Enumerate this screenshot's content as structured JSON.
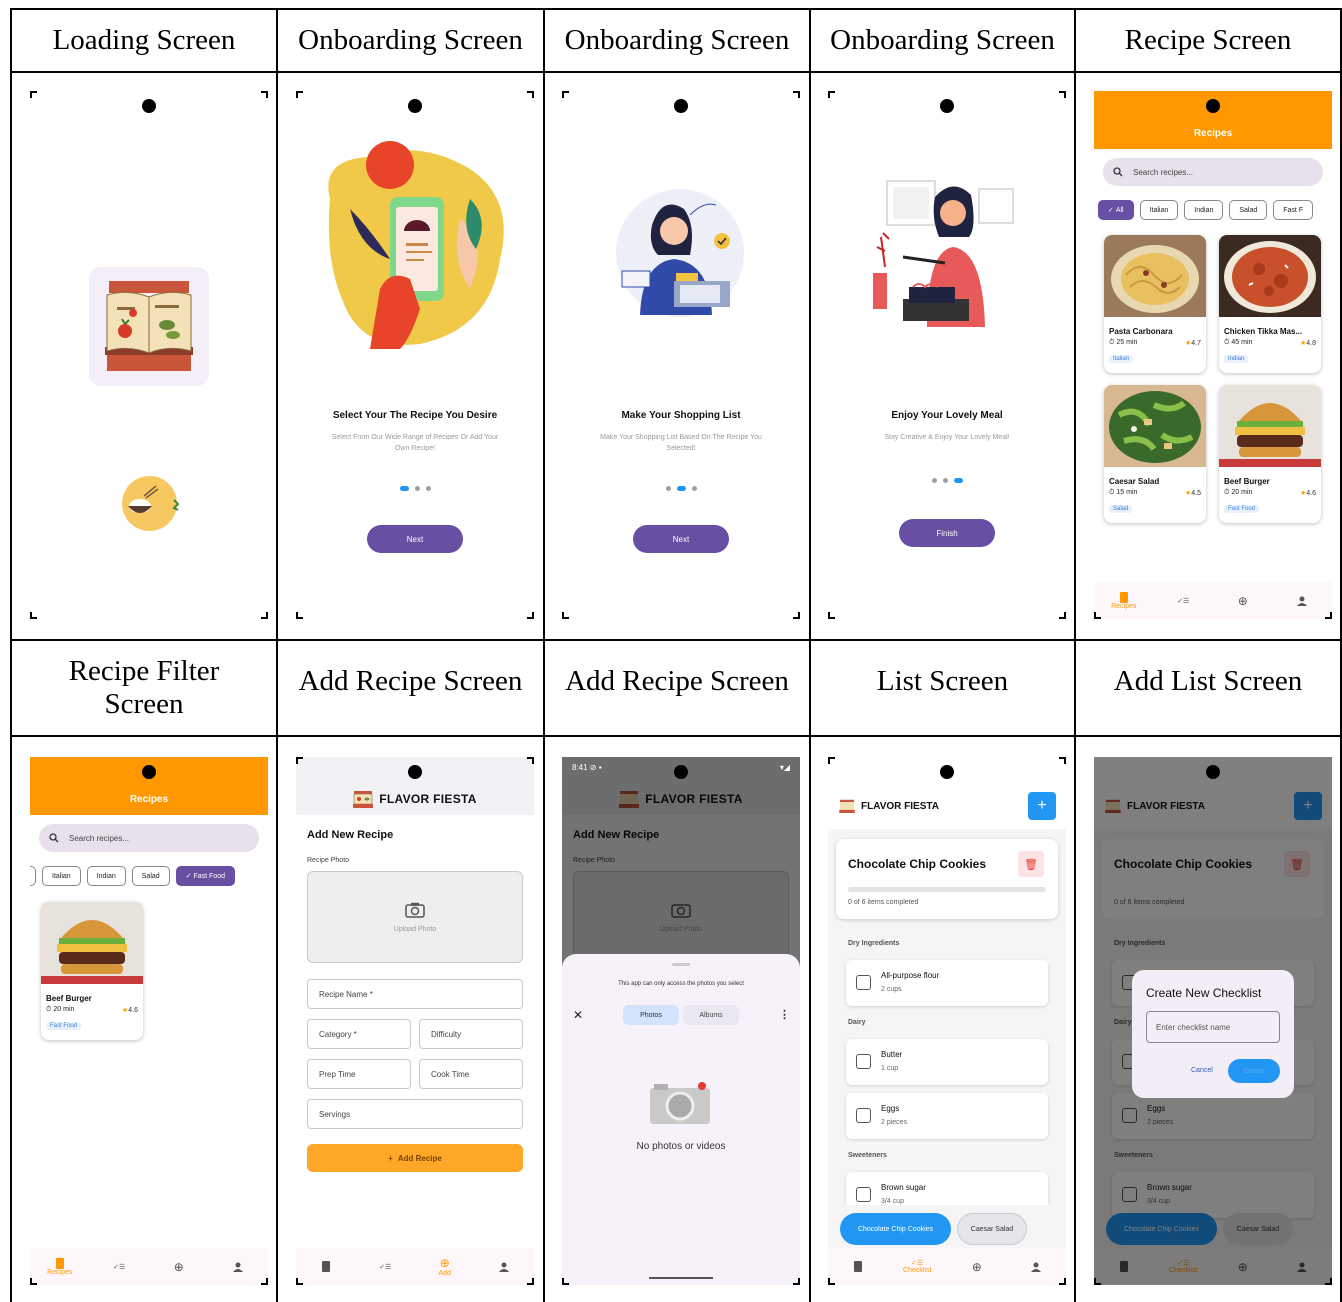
{
  "headers": [
    "Loading Screen",
    "Onboarding Screen",
    "Onboarding Screen",
    "Onboarding Screen",
    "Recipe Screen",
    "Recipe Filter Screen",
    "Add Recipe Screen",
    "Add Recipe Screen",
    "List Screen",
    "Add List Screen"
  ],
  "colors": {
    "accent": "#6750a4",
    "orange": "#ff9800",
    "blue": "#2196f3"
  },
  "onboarding": [
    {
      "title": "Select Your The Recipe You Desire",
      "subtitle": "Select From Our Wide Range of Recipes Or Add Your Own Recipe!",
      "button": "Next"
    },
    {
      "title": "Make Your Shopping List",
      "subtitle": "Make Your Shopping List Based On The Recipe You Selected!",
      "button": "Next"
    },
    {
      "title": "Enjoy Your Lovely Meal",
      "subtitle": "Stay Creative & Enjoy Your Lovely Meal!",
      "button": "Finish"
    }
  ],
  "recipes": {
    "title": "Recipes",
    "search_placeholder": "Search recipes...",
    "chips": [
      "All",
      "Italian",
      "Indian",
      "Salad",
      "Fast F"
    ],
    "filter_chips": [
      "Italian",
      "Indian",
      "Salad",
      "Fast Food"
    ],
    "cards": [
      {
        "name": "Pasta Carbonara",
        "time": "25 min",
        "rating": "4.7",
        "tag": "Italian"
      },
      {
        "name": "Chicken Tikka Mas...",
        "time": "45 min",
        "rating": "4.8",
        "tag": "Indian"
      },
      {
        "name": "Caesar Salad",
        "time": "15 min",
        "rating": "4.5",
        "tag": "Salad"
      },
      {
        "name": "Beef Burger",
        "time": "20 min",
        "rating": "4.6",
        "tag": "Fast Food"
      }
    ]
  },
  "nav": {
    "recipes": "Recipes",
    "add": "Add",
    "checklist": "Checklist"
  },
  "brand": "FLAVOR FIESTA",
  "add_recipe": {
    "heading": "Add New Recipe",
    "photo_label": "Recipe Photo",
    "upload": "Upload Photo",
    "name": "Recipe Name *",
    "category": "Category *",
    "difficulty": "Difficulty",
    "prep": "Prep Time",
    "cook": "Cook Time",
    "servings": "Servings",
    "button": "Add Recipe"
  },
  "picker": {
    "status_time": "8:41",
    "notice": "This app can only access the photos you select",
    "tab_photos": "Photos",
    "tab_albums": "Albums",
    "empty": "No photos or videos"
  },
  "checklist": {
    "title": "Chocolate Chip Cookies",
    "progress": "0 of 6 items completed",
    "progress_fraction": 0,
    "sections": [
      {
        "name": "Dry Ingredients",
        "items": [
          {
            "name": "All-purpose flour",
            "qty": "2 cups"
          }
        ]
      },
      {
        "name": "Dairy",
        "items": [
          {
            "name": "Butter",
            "qty": "1 cup"
          },
          {
            "name": "Eggs",
            "qty": "2 pieces"
          }
        ]
      },
      {
        "name": "Sweeteners",
        "items": [
          {
            "name": "Brown sugar",
            "qty": "3/4 cup"
          }
        ]
      }
    ],
    "tabs": [
      "Chocolate Chip Cookies",
      "Caesar Salad"
    ]
  },
  "dialog": {
    "title": "Create New Checklist",
    "placeholder": "Enter checklist name",
    "cancel": "Cancel",
    "create": "Create"
  }
}
